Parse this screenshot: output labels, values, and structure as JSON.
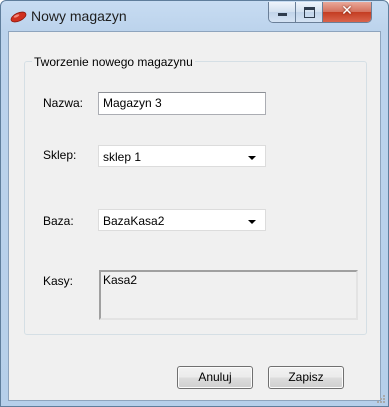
{
  "window": {
    "title": "Nowy magazyn",
    "close_glyph": "✕"
  },
  "group": {
    "legend": "Tworzenie nowego magazynu"
  },
  "fields": {
    "nazwa": {
      "label": "Nazwa:",
      "value": "Magazyn 3"
    },
    "sklep": {
      "label": "Sklep:",
      "value": "sklep 1"
    },
    "baza": {
      "label": "Baza:",
      "value": "BazaKasa2"
    },
    "kasy": {
      "label": "Kasy:",
      "items": [
        "Kasa2"
      ]
    }
  },
  "buttons": {
    "cancel": "Anuluj",
    "save": "Zapisz"
  },
  "icons": {
    "app": "red-pill-icon",
    "minimize": "minimize-icon",
    "maximize": "maximize-icon",
    "close": "close-icon",
    "dropdown": "chevron-down-icon"
  },
  "colors": {
    "title_bar": "#c7dcf2",
    "close_button": "#c43d22",
    "client_background": "#f0f0f0",
    "app_icon": "#d0301f"
  }
}
